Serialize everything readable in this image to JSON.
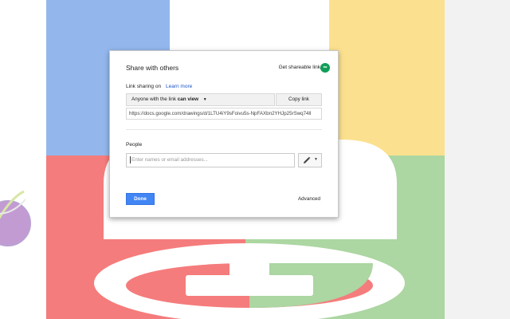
{
  "colors": {
    "blue": "#93b7ec",
    "yellow": "#fbe18f",
    "red": "#f57c7c",
    "green": "#acd6a2",
    "accent": "#4285f4",
    "link_green": "#0f9d58"
  },
  "dialog": {
    "title": "Share with others",
    "get_shareable_link": "Get shareable link",
    "shareable_icon": "link-icon",
    "link_sharing_label": "Link sharing on",
    "learn_more": "Learn more",
    "access_prefix": "Anyone with the link",
    "access_level": "can view",
    "copy_link": "Copy link",
    "url": "https://docs.google.com/drawings/d/1LTU4iY9sFoivu5s-NpFAXbn2YHJp25rSwq74ll",
    "people_label": "People",
    "people_placeholder": "Enter names or email addresses...",
    "edit_icon": "pencil-icon",
    "done": "Done",
    "advanced": "Advanced"
  }
}
